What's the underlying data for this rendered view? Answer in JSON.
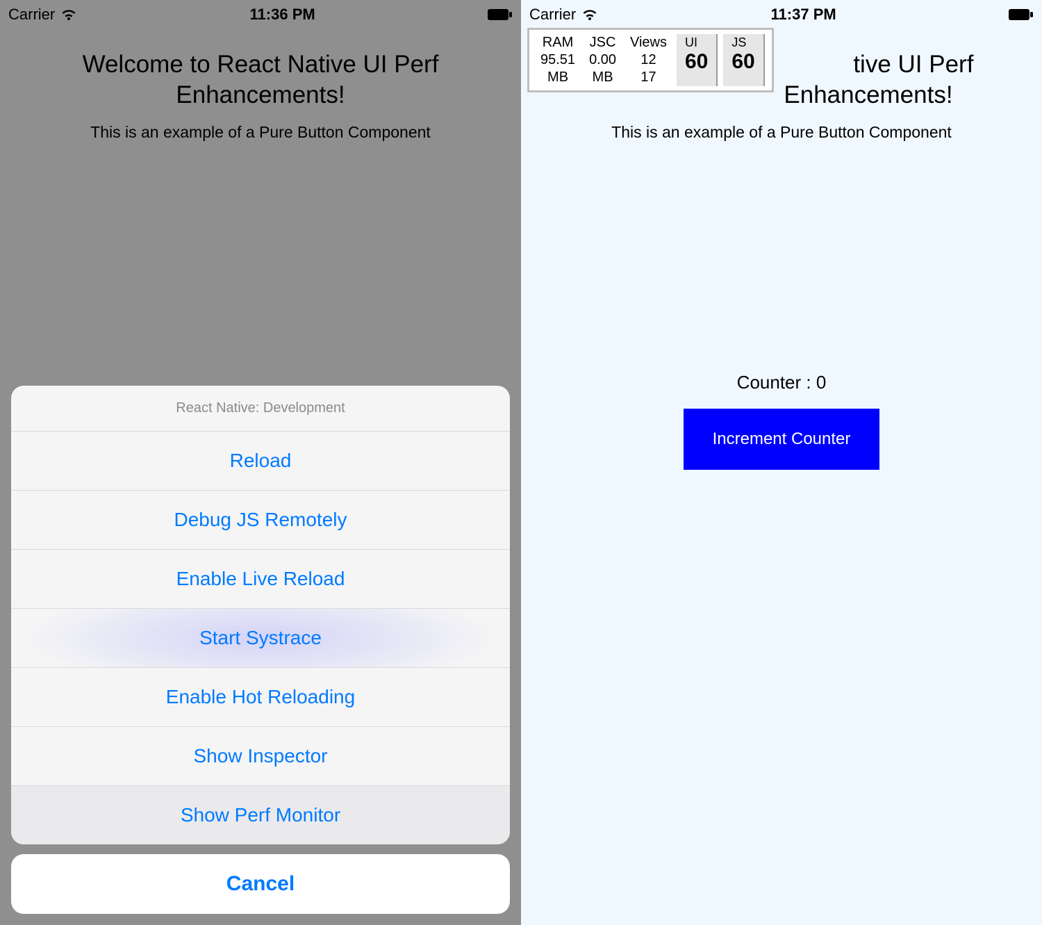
{
  "left": {
    "statusbar": {
      "carrier": "Carrier",
      "time": "11:36 PM"
    },
    "title": "Welcome to React Native UI Perf Enhancements!",
    "subtitle": "This is an example of a Pure Button Component",
    "actionsheet": {
      "title": "React Native: Development",
      "items": [
        {
          "label": "Reload",
          "state": ""
        },
        {
          "label": "Debug JS Remotely",
          "state": ""
        },
        {
          "label": "Enable Live Reload",
          "state": ""
        },
        {
          "label": "Start Systrace",
          "state": "pressed"
        },
        {
          "label": "Enable Hot Reloading",
          "state": ""
        },
        {
          "label": "Show Inspector",
          "state": ""
        },
        {
          "label": "Show Perf Monitor",
          "state": "selected"
        }
      ],
      "cancel": "Cancel"
    }
  },
  "right": {
    "statusbar": {
      "carrier": "Carrier",
      "time": "11:37 PM"
    },
    "title": "Welcome to React Native UI Perf Enhancements!",
    "subtitle": "This is an example of a Pure Button Component",
    "perf": {
      "ram": {
        "label": "RAM",
        "value": "95.51",
        "unit": "MB"
      },
      "jsc": {
        "label": "JSC",
        "value": "0.00",
        "unit": "MB"
      },
      "views": {
        "label": "Views",
        "v1": "12",
        "v2": "17"
      },
      "ui": {
        "label": "UI",
        "fps": "60"
      },
      "js": {
        "label": "JS",
        "fps": "60"
      }
    },
    "counter_label": "Counter : 0",
    "button_label": "Increment Counter"
  },
  "colors": {
    "ios_blue": "#007aff",
    "btn_blue": "#0000ff"
  }
}
